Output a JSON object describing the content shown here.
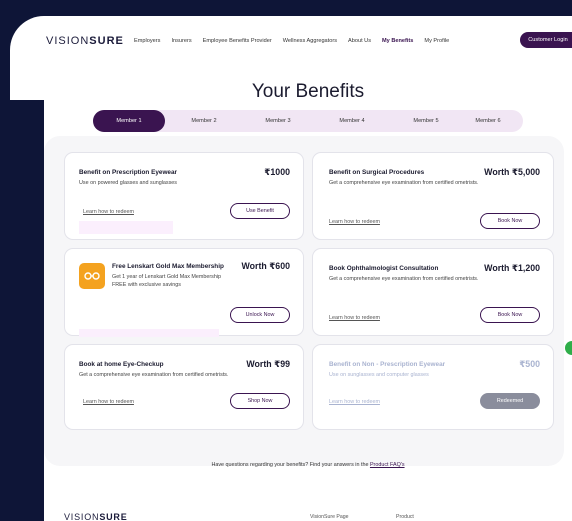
{
  "header": {
    "logo_prefix": "VISI",
    "logo_o": "ON",
    "logo_suffix": "SURE",
    "nav": [
      "Employers",
      "Insurers",
      "Employee Benefits Provider",
      "Wellness Aggregators",
      "About Us",
      "My Benefits",
      "My Profile"
    ],
    "active_nav": "My Benefits",
    "login_label": "Customer Login"
  },
  "page": {
    "title": "Your Benefits"
  },
  "tabs": [
    "Member 1",
    "Member 2",
    "Member 3",
    "Member 4",
    "Member 5",
    "Member 6"
  ],
  "active_tab": "Member 1",
  "cards": [
    {
      "title": "Benefit on Prescription Eyewear",
      "price": "₹1000",
      "desc": "Use on powered glasses and sunglasses",
      "link": "Learn how to redeem",
      "button": "Use Benefit"
    },
    {
      "title": "Benefit on Surgical Procedures",
      "price": "Worth ₹5,000",
      "desc": "Get a comprehensive eye examination from certified ometrists.",
      "link": "Learn how to redeem",
      "button": "Book Now"
    },
    {
      "title": "Free Lenskart Gold Max Membership",
      "price": "Worth ₹600",
      "desc": "Get 1 year of Lenskart Gold Max Membership FREE with exclusive savings",
      "link": "",
      "button": "Unlock Now",
      "icon": "lenskart-gold-icon"
    },
    {
      "title": "Book Ophthalmologist Consultation",
      "price": "Worth ₹1,200",
      "desc": "Get a comprehensive eye examination from certified ometrists.",
      "link": "Learn how to redeem",
      "button": "Book Now"
    },
    {
      "title": "Book at home Eye-Checkup",
      "price": "Worth ₹99",
      "desc": "Get a comprehensive eye examination from certified ometrists.",
      "link": "Learn how to redeem",
      "button": "Shop Now"
    },
    {
      "title": "Benefit on Non - Prescription Eyewear",
      "price": "₹500",
      "desc": "Use on sunglasses and computer glasses",
      "link": "Learn how to redeem",
      "button": "Redeemed"
    }
  ],
  "faq": {
    "text": "Have questions regarding your benefits? Find your answers in the",
    "link": "Product FAQ's"
  },
  "footer": {
    "logo_prefix": "VISI",
    "logo_o": "ON",
    "logo_suffix": "SURE",
    "links": [
      "VisionSure Page",
      "Product"
    ]
  },
  "colors": {
    "primary": "#3a1450",
    "tab_bg": "#f1e6f4",
    "dark_bg": "#0e1537",
    "accent_icon": "#f4a21f",
    "disabled": "#8a8d9c"
  }
}
